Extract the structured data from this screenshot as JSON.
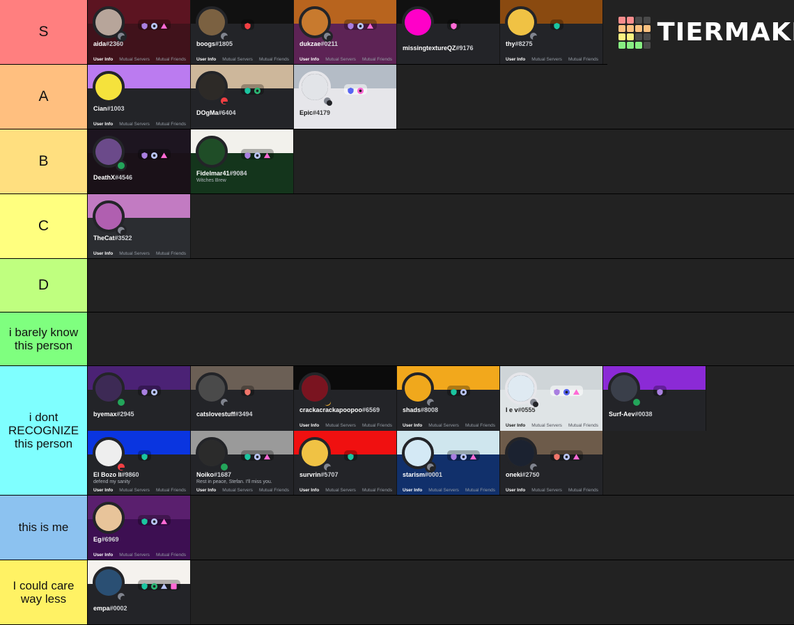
{
  "logo": {
    "text": "TIERMAKER",
    "grid": [
      "#f98d8d",
      "#f98d8d",
      "#4a4a4a",
      "#4a4a4a",
      "#fbc180",
      "#fbc180",
      "#fbc180",
      "#fbc180",
      "#fbf481",
      "#fbf481",
      "#4a4a4a",
      "#4a4a4a",
      "#87ee82",
      "#87ee82",
      "#87ee82",
      "#4a4a4a"
    ]
  },
  "card_tabs": {
    "user_info": "User Info",
    "mutual_servers": "Mutual Servers",
    "mutual_friends": "Mutual Friends"
  },
  "tiers": [
    {
      "label": "S",
      "color": "#ff7f7f",
      "height": 93,
      "cards": [
        {
          "name": "aida",
          "disc": "#2360",
          "banner": "#5c1421",
          "body": "#40121b",
          "avatar_bg": "#b7a59a",
          "status": "offline",
          "badges": [
            "#a97fe0",
            "#b9c4f5",
            "#ff6ad5"
          ],
          "show_tabs": true
        },
        {
          "name": "boogs",
          "disc": "#1805",
          "banner": "#111111",
          "body": "#232428",
          "avatar_bg": "#7b6141",
          "status": "offline",
          "badges": [
            "#f23f43"
          ],
          "show_tabs": true
        },
        {
          "name": "dukzae",
          "disc": "#0211",
          "banner": "#b8641e",
          "body": "#5d2355",
          "avatar_bg": "#c87a2e",
          "status": "offline",
          "badges": [
            "#a97fe0",
            "#b9c4f5",
            "#ff6ad5"
          ],
          "show_tabs": true
        },
        {
          "name": "missingtextureQZ",
          "disc": "#9176",
          "banner": "#111111",
          "body": "#232428",
          "avatar_bg": "#ff00c8",
          "status": "none",
          "badges": [
            "#ff6ad5"
          ],
          "show_tabs": false
        },
        {
          "name": "thy",
          "disc": "#8275",
          "banner": "#8a4a10",
          "body": "#232428",
          "avatar_bg": "#f0c244",
          "status": "offline",
          "badges": [
            "#1bc5a0"
          ],
          "show_tabs": true
        }
      ]
    },
    {
      "label": "A",
      "color": "#ffbf7f",
      "height": 93,
      "cards": [
        {
          "name": "Cian",
          "disc": "#1003",
          "banner": "#bb7bf0",
          "body": "#232428",
          "avatar_bg": "#f5e23c",
          "status": "none",
          "badges": [],
          "show_tabs": true
        },
        {
          "name": "DOgMa",
          "disc": "#6404",
          "banner": "#cdb79b",
          "body": "#232428",
          "avatar_bg": "#2d2a27",
          "status": "dnd",
          "badges": [
            "#1bc5a0",
            "#2bb673"
          ],
          "show_tabs": false
        },
        {
          "name": "Epic",
          "disc": "#4179",
          "banner": "#b4bcc6",
          "body": "#e6e6ea",
          "light": true,
          "avatar_bg": "#e2e4e8",
          "status": "offline",
          "badges": [
            "#5865f2",
            "#ff6ad5"
          ],
          "show_tabs": false
        }
      ]
    },
    {
      "label": "B",
      "color": "#ffdf7f",
      "height": 93,
      "cards": [
        {
          "name": "DeathX",
          "disc": "#4546",
          "banner": "#1d1520",
          "body": "#1a1118",
          "avatar_bg": "#6b4a8a",
          "status": "online",
          "badges": [
            "#a97fe0",
            "#b9c4f5",
            "#ff6ad5"
          ],
          "show_tabs": false
        },
        {
          "name": "Fidelmar41",
          "disc": "#9084",
          "banner": "#f2f1ec",
          "body": "#14351c",
          "avatar_bg": "#1f4d27",
          "status": "none",
          "badges": [
            "#a97fe0",
            "#b9c4f5",
            "#ff6ad5"
          ],
          "custom_status": "Witches Brew",
          "show_tabs": false
        }
      ]
    },
    {
      "label": "C",
      "color": "#ffff7f",
      "height": 93,
      "cards": [
        {
          "name": "TheCat",
          "disc": "#3522",
          "banner": "#c27bc2",
          "body": "#2b2d31",
          "avatar_bg": "#b05fb0",
          "status": "offline",
          "badges": [],
          "show_tabs": true
        }
      ]
    },
    {
      "label": "D",
      "color": "#bfff7f",
      "height": 86,
      "cards": []
    },
    {
      "label": "i barely know this person",
      "color": "#7fff7f",
      "height": 86,
      "small": true,
      "cards": []
    },
    {
      "label": "i dont RECOGNIZE this person",
      "color": "#7fffff",
      "height": 186,
      "small": true,
      "cards": [
        {
          "name": "byemax",
          "disc": "#2945",
          "banner": "#4b2275",
          "body": "#232428",
          "avatar_bg": "#3d2a55",
          "status": "online",
          "badges": [
            "#a97fe0",
            "#b9c4f5"
          ],
          "show_tabs": false
        },
        {
          "name": "catslovestuff",
          "disc": "#3494",
          "banner": "#6b5f55",
          "body": "#232428",
          "avatar_bg": "#4a4a4a",
          "status": "offline",
          "badges": [
            "#f0756a"
          ],
          "show_tabs": false
        },
        {
          "name": "crackacrackapoopoo",
          "disc": "#6569",
          "banner": "#0b0b0b",
          "body": "#232428",
          "avatar_bg": "#7a1420",
          "status": "idle",
          "badges": [],
          "show_tabs": true
        },
        {
          "name": "shads",
          "disc": "#8008",
          "banner": "#f2a81c",
          "body": "#232428",
          "avatar_bg": "#f0a81c",
          "status": "offline",
          "badges": [
            "#1bc5a0",
            "#b9c4f5"
          ],
          "show_tabs": true
        },
        {
          "name": "I e v",
          "disc": "#0555",
          "banner": "#cfd5d8",
          "body": "#dfe4e6",
          "light": true,
          "avatar_bg": "#dfeaf2",
          "status": "offline",
          "badges": [
            "#a97fe0",
            "#5865f2",
            "#ff6ad5"
          ],
          "show_tabs": true
        },
        {
          "name": "Surf-Aev",
          "disc": "#0038",
          "banner": "#8b2ad6",
          "body": "#232428",
          "avatar_bg": "#3a3f4a",
          "status": "online",
          "badges": [
            "#a97fe0"
          ],
          "show_tabs": false,
          "clipped": true
        },
        {
          "name": "El Bozo II",
          "disc": "#9860",
          "banner": "#0a35e0",
          "body": "#232428",
          "avatar_bg": "#eeeeee",
          "status": "dnd",
          "badges": [
            "#1bc5a0"
          ],
          "custom_status": "defend my sanity",
          "show_tabs": true
        },
        {
          "name": "Noiko",
          "disc": "#1687",
          "banner": "#9a9a9a",
          "body": "#232428",
          "avatar_bg": "#2b2b2b",
          "status": "online",
          "badges": [
            "#1bc5a0",
            "#b9c4f5",
            "#ff6ad5"
          ],
          "custom_status": "Rest in peace, Stefan. I'll miss you.",
          "show_tabs": true
        },
        {
          "name": "survrin",
          "disc": "#5707",
          "banner": "#f01010",
          "body": "#232428",
          "avatar_bg": "#f0c244",
          "status": "offline",
          "badges": [
            "#1bc5a0"
          ],
          "show_tabs": true
        },
        {
          "name": "starism",
          "disc": "#0001",
          "banner": "#cfe6ee",
          "body": "#11306b",
          "avatar_bg": "#d4e9f5",
          "status": "offline",
          "badges": [
            "#a97fe0",
            "#b9c4f5",
            "#ff6ad5"
          ],
          "show_tabs": true
        },
        {
          "name": "oneki",
          "disc": "#2750",
          "banner": "#6d5b4a",
          "body": "#232428",
          "avatar_bg": "#1b2230",
          "status": "offline",
          "badges": [
            "#f0756a",
            "#b9c4f5",
            "#ff6ad5"
          ],
          "show_tabs": true
        }
      ]
    },
    {
      "label": "this is me",
      "color": "#8cc2f0",
      "height": 93,
      "small": true,
      "cards": [
        {
          "name": "Eg",
          "disc": "#6969",
          "banner": "#5a1f6e",
          "body": "#3d0f52",
          "avatar_bg": "#e8c49a",
          "status": "none",
          "badges": [
            "#1bc5a0",
            "#b9c4f5",
            "#ff6ad5"
          ],
          "show_tabs": true
        }
      ]
    },
    {
      "label": "I could care way less",
      "color": "#fff264",
      "height": 93,
      "small": true,
      "cards": [
        {
          "name": "empa",
          "disc": "#0002",
          "banner": "#f5f2ee",
          "body": "#232428",
          "avatar_bg": "#2a4f73",
          "status": "offline",
          "badges": [
            "#1bc5a0",
            "#2bb673",
            "#b9c4f5",
            "#ff6ad5"
          ],
          "show_tabs": false
        }
      ]
    }
  ]
}
